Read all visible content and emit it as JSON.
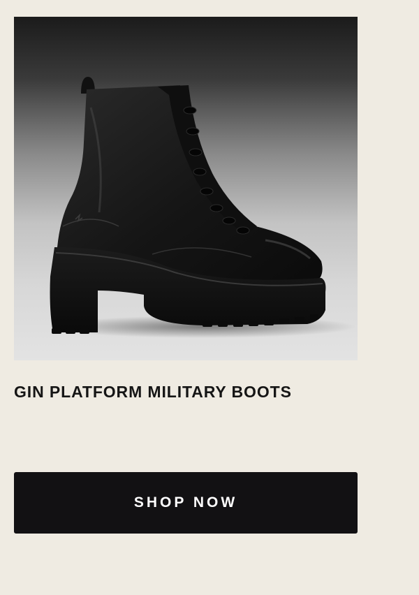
{
  "product": {
    "title": "GIN PLATFORM MILITARY BOOTS",
    "image_subject": "black-platform-military-boot"
  },
  "cta": {
    "label": "SHOP NOW"
  },
  "colors": {
    "background": "#efebe2",
    "button_bg": "#121113",
    "button_text": "#ffffff",
    "title_text": "#151515"
  }
}
